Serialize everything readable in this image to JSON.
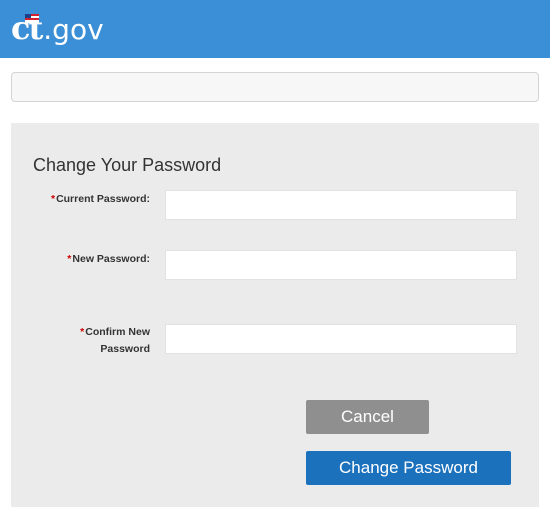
{
  "header": {
    "logo": {
      "ct": "ct",
      "gov": ".gov"
    },
    "background_color": "#3a8fd6"
  },
  "form": {
    "title": "Change Your Password",
    "required_marker": "*",
    "fields": [
      {
        "label": "Current Password:",
        "value": ""
      },
      {
        "label": "New Password:",
        "value": ""
      },
      {
        "label_line1": "Confirm New",
        "label_line2": "Password",
        "value": ""
      }
    ]
  },
  "buttons": {
    "cancel": "Cancel",
    "change_password": "Change Password"
  },
  "colors": {
    "cancel_button": "#8f8f8f",
    "primary_button": "#1c71bd",
    "required": "#cc0000",
    "panel": "#ebebeb"
  }
}
